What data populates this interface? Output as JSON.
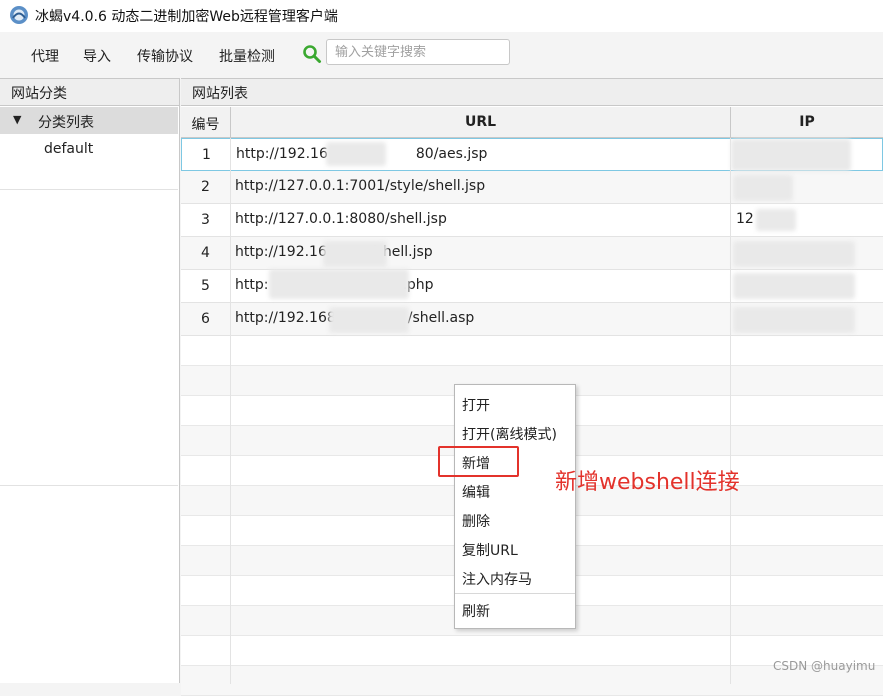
{
  "window": {
    "title": "冰蝎v4.0.6 动态二进制加密Web远程管理客户端"
  },
  "menubar": {
    "items": [
      "代理",
      "导入",
      "传输协议",
      "批量检测"
    ],
    "search_placeholder": "输入关键字搜索"
  },
  "left_panel": {
    "title": "网站分类",
    "tree_root": "分类列表",
    "tree_child": "default"
  },
  "right_panel": {
    "title": "网站列表",
    "columns": {
      "id": "编号",
      "url": "URL",
      "ip": "IP"
    },
    "rows": [
      {
        "id": "1",
        "url_a": "http://192.16",
        "url_b": "80/aes.jsp",
        "ip": ""
      },
      {
        "id": "2",
        "url_a": "http://127.0.0.1:7001/style/shell.jsp",
        "url_b": "",
        "ip": ""
      },
      {
        "id": "3",
        "url_a": "http://127.0.0.1:8080/shell.jsp",
        "url_b": "",
        "ip": "12"
      },
      {
        "id": "4",
        "url_a": "http://192.16",
        "url_b": "/shell.jsp",
        "ip": ""
      },
      {
        "id": "5",
        "url_a": "http:",
        "url_b": ".php",
        "ip": ""
      },
      {
        "id": "6",
        "url_a": "http://192.168",
        "url_b": "/shell.asp",
        "ip": ""
      }
    ]
  },
  "context_menu": {
    "items": [
      "打开",
      "打开(离线模式)",
      "新增",
      "编辑",
      "删除",
      "复制URL",
      "注入内存马",
      "刷新"
    ]
  },
  "annotation": {
    "text": "新增webshell连接",
    "color": "#e3322b"
  },
  "watermark": "CSDN @huayimu"
}
